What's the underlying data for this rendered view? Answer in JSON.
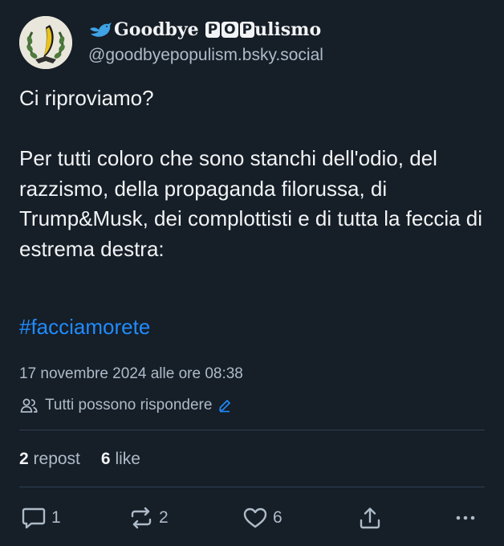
{
  "author": {
    "display_name_prefix": "Goodbye",
    "display_name_boxes": [
      "P",
      "O",
      "P"
    ],
    "display_name_suffix": "ulismo",
    "handle": "@goodbyepopulism.bsky.social",
    "avatar_icon": "laurel-banana-emblem",
    "name_emoji_icon": "blue-bird-icon"
  },
  "post": {
    "text": "Ci riproviamo?\n\nPer tutti coloro che sono stanchi dell'odio, del razzismo, della propaganda filorussa, di Trump&Musk, dei complottisti e di tutta la feccia di estrema destra:",
    "hashtag": "#facciamorete",
    "timestamp": "17 novembre 2024 alle ore 08:38",
    "reply_setting": "Tutti possono rispondere"
  },
  "stats": {
    "reposts": {
      "count": "2",
      "label": "repost"
    },
    "likes": {
      "count": "6",
      "label": "like"
    }
  },
  "actions": {
    "reply": {
      "icon": "comment-icon",
      "count": "1"
    },
    "repost": {
      "icon": "repost-icon",
      "count": "2"
    },
    "like": {
      "icon": "heart-icon",
      "count": "6"
    },
    "share": {
      "icon": "share-icon"
    },
    "more": {
      "icon": "more-icon"
    }
  },
  "colors": {
    "background": "#161e27",
    "text": "#f1f3f5",
    "secondary_text": "#aebbc9",
    "link": "#208bfe",
    "divider": "#2e4052"
  }
}
